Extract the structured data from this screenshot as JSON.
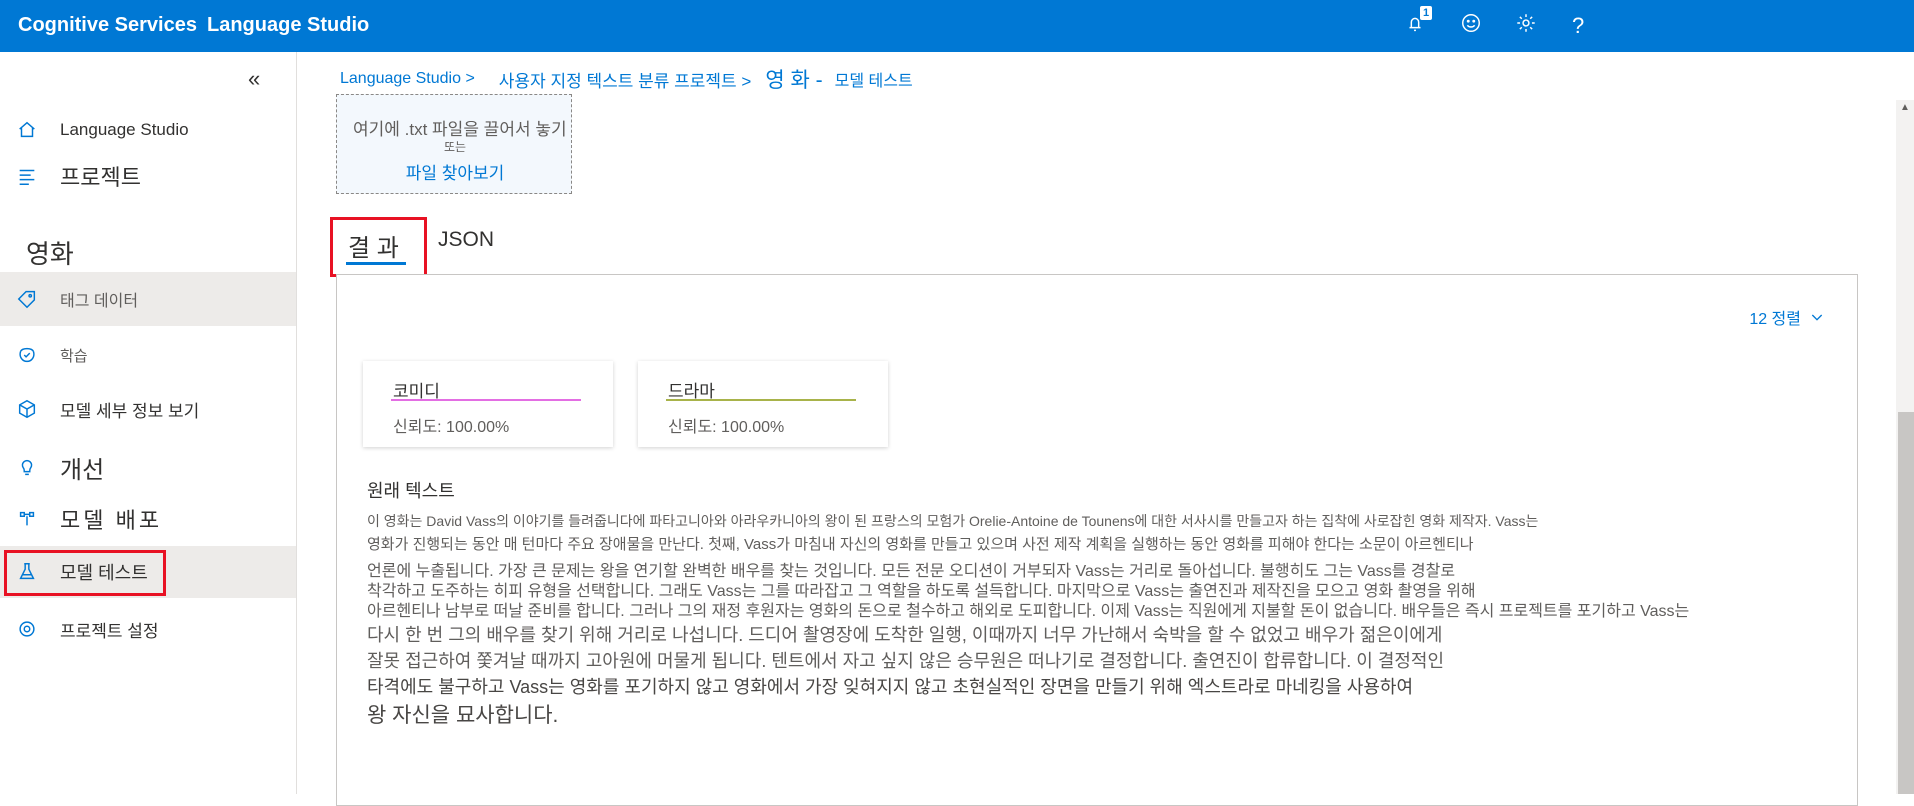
{
  "topbar": {
    "brand_primary": "Cognitive Services",
    "brand_secondary": "Language Studio",
    "notification_count": "1",
    "help_label": "?"
  },
  "sidebar": {
    "collapse_label": "«",
    "items": [
      {
        "label": "Language Studio",
        "icon": "home-icon"
      },
      {
        "label": "프로젝트",
        "icon": "list-icon"
      }
    ],
    "project_name": "영화",
    "project_items": [
      {
        "label": "태그 데이터",
        "icon": "tag-icon"
      },
      {
        "label": "학습",
        "icon": "train-icon"
      },
      {
        "label": "모델 세부 정보 보기",
        "icon": "cube-icon"
      }
    ],
    "improve_head": "개선",
    "deploy_label": "모델 배포",
    "test_label": "모델 테스트",
    "settings_label": "프로젝트 설정"
  },
  "breadcrumb": {
    "root": "Language Studio >",
    "project_type": "사용자 지정 텍스트 분류 프로젝트 >",
    "project": "영 화 -",
    "page": "모델 테스트"
  },
  "upload": {
    "drop_text": "여기에 .txt 파일을 끌어서 놓기",
    "or_text": "또는",
    "browse_text": "파일 찾아보기"
  },
  "tabs": {
    "results": "결 과",
    "json": "JSON"
  },
  "results": {
    "sort_label": "12 정렬",
    "cards": [
      {
        "class": "코미디",
        "confidence": "신뢰도: 100.00%",
        "color": "#e36ee3"
      },
      {
        "class": "드라마",
        "confidence": "신뢰도: 100.00%",
        "color": "#a8b34a"
      }
    ],
    "original_title": "원래 텍스트",
    "original_lines": [
      "이 영화는 David Vass의 이야기를 들려줍니다에 파타고니아와 아라우카니아의 왕이 된 프랑스의 모험가 Orelie-Antoine de Tounens에 대한 서사시를 만들고자 하는 집착에 사로잡힌 영화 제작자. Vass는",
      "영화가 진행되는 동안 매 턴마다 주요 장애물을 만난다. 첫째, Vass가 마침내 자신의 영화를 만들고 있으며 사전 제작 계획을 실행하는 동안 영화를 피해야 한다는 소문이 아르헨티나",
      "언론에 누출됩니다. 가장 큰 문제는 왕을 연기할 완벽한 배우를 찾는 것입니다. 모든 전문 오디션이 거부되자 Vass는 거리로 돌아섭니다. 불행히도 그는 Vass를 경찰로",
      "착각하고 도주하는 히피 유형을 선택합니다. 그래도 Vass는 그를 따라잡고 그 역할을 하도록 설득합니다. 마지막으로 Vass는 출연진과 제작진을 모으고 영화 촬영을 위해",
      "아르헨티나 남부로 떠날 준비를 합니다. 그러나 그의 재정 후원자는 영화의 돈으로 철수하고 해외로 도피합니다. 이제 Vass는 직원에게 지불할 돈이 없습니다. 배우들은 즉시 프로젝트를 포기하고 Vass는",
      "다시 한 번 그의 배우를 찾기 위해 거리로 나섭니다. 드디어 촬영장에 도착한 일행, 이때까지 너무 가난해서 숙박을 할 수 없었고 배우가 젊은이에게",
      "잘못 접근하여 쫓겨날 때까지 고아원에 머물게 됩니다. 텐트에서 자고 싶지 않은 승무원은 떠나기로 결정합니다. 출연진이 합류합니다. 이 결정적인",
      "타격에도 불구하고 Vass는 영화를 포기하지 않고 영화에서 가장 잊혀지지 않고 초현실적인 장면을 만들기 위해 엑스트라로 마네킹을 사용하여",
      "왕 자신을 묘사합니다."
    ]
  },
  "colors": {
    "accent": "#0078d4",
    "highlight_box": "#e81123"
  }
}
